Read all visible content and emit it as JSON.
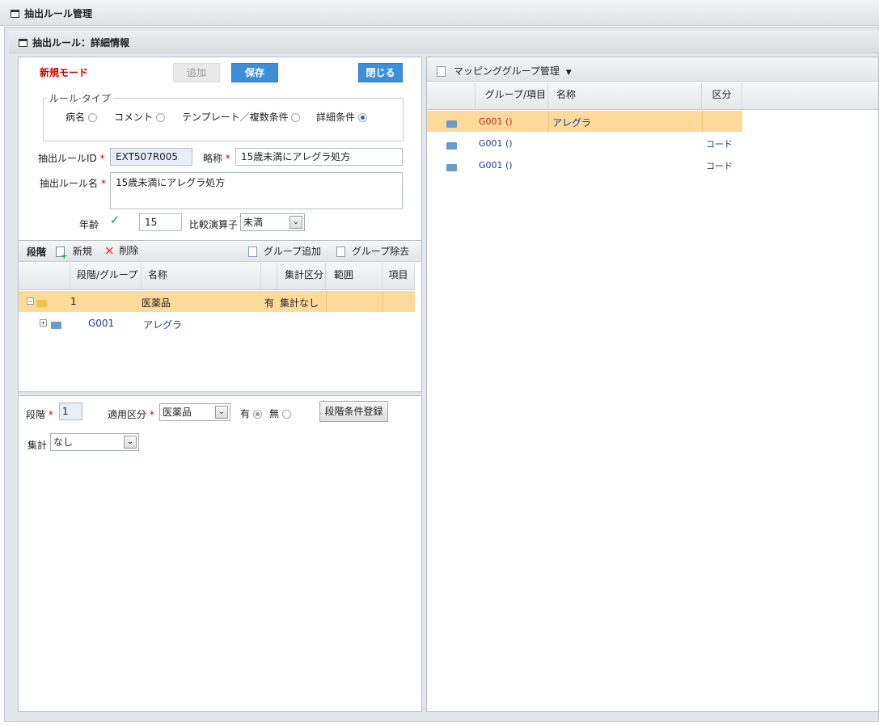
{
  "app": {
    "title": "抽出ルール管理",
    "detail_title": "抽出ルール：詳細情報"
  },
  "form": {
    "mode": "新規モード",
    "add_btn": "追加",
    "save_btn": "保存",
    "close_btn": "閉じる",
    "rule_type_legend": "ルール·タイプ",
    "rule_types": [
      "病名",
      "コメント",
      "テンプレート／複数条件",
      "詳細条件"
    ],
    "rule_type_selected": "詳細条件",
    "id_label": "抽出ルールID",
    "id_value": "EXT507R005",
    "short_label": "略称",
    "short_value": "15歳未満にアレグラ処方",
    "name_label": "抽出ルール名",
    "name_value": "15歳未満にアレグラ処方",
    "age_label": "年齢",
    "age_value": "15",
    "op_label": "比較演算子",
    "op_value": "未満"
  },
  "stage": {
    "title": "段階",
    "new_btn": "新規",
    "delete_btn": "削除",
    "group_add_btn": "グループ追加",
    "group_remove_btn": "グループ除去",
    "columns": [
      "段階/グループ",
      "名称",
      "集計区分",
      "範囲",
      "項目"
    ],
    "rows": [
      {
        "stage": "1",
        "name": "医薬品",
        "flag": "有",
        "agg": "集計なし"
      },
      {
        "stage": "G001",
        "name": "アレグラ"
      }
    ]
  },
  "cond": {
    "stage_label": "段階",
    "stage_value": "1",
    "apply_label": "適用区分",
    "apply_value": "医薬品",
    "yes_label": "有",
    "no_label": "無",
    "register_btn": "段階条件登録",
    "agg_label": "集計",
    "agg_value": "なし"
  },
  "mapping": {
    "title": "マッピンググループ管理",
    "columns": [
      "グループ/項目",
      "名称",
      "区分"
    ],
    "rows": [
      {
        "group": "G001 ()",
        "name": "アレグラ",
        "kubun": ""
      },
      {
        "group": "G001 ()",
        "name": "",
        "kubun": "コード"
      },
      {
        "group": "G001 ()",
        "name": "",
        "kubun": "コード"
      }
    ]
  }
}
